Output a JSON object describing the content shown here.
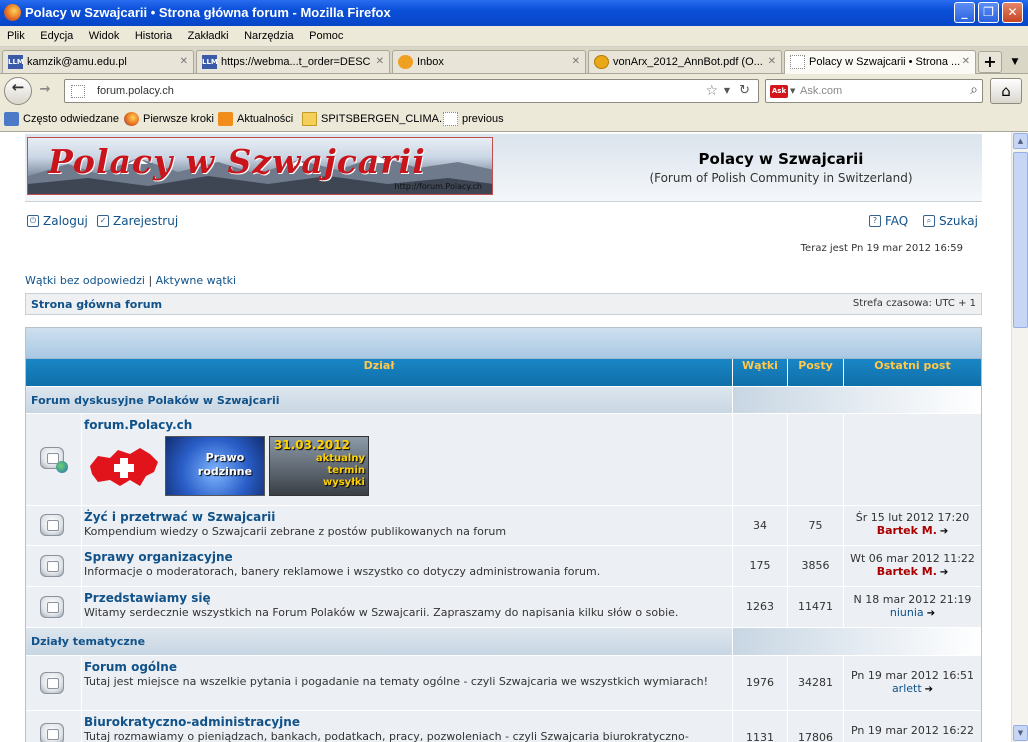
{
  "window": {
    "title": "Polacy w Szwajcarii • Strona główna forum - Mozilla Firefox",
    "controls": {
      "minimize": "_",
      "maximize": "❐",
      "close": "✕"
    }
  },
  "menu": [
    "Plik",
    "Edycja",
    "Widok",
    "Historia",
    "Zakładki",
    "Narzędzia",
    "Pomoc"
  ],
  "tabs": [
    {
      "label": "kamzik@amu.edu.pl",
      "icon": "llm",
      "icon_text": "LLM"
    },
    {
      "label": "https://webma...t_order=DESC",
      "icon": "llm",
      "icon_text": "LLM"
    },
    {
      "label": "Inbox",
      "icon": "inbox"
    },
    {
      "label": "vonArx_2012_AnnBot.pdf (O...",
      "icon": "pdf"
    },
    {
      "label": "Polacy w Szwajcarii • Strona ...",
      "icon": "blank",
      "active": true
    }
  ],
  "newtab": "+",
  "toolbar": {
    "url": "forum.polacy.ch",
    "search_placeholder": "Ask.com",
    "search_engine": "Ask"
  },
  "bookmarks": [
    {
      "label": "Często odwiedzane",
      "icon": "mv"
    },
    {
      "label": "Pierwsze kroki",
      "icon": "ff"
    },
    {
      "label": "Aktualności",
      "icon": "rss"
    },
    {
      "label": "SPITSBERGEN_CLIMA...",
      "icon": "folder"
    },
    {
      "label": "previous",
      "icon": "blank"
    }
  ],
  "site": {
    "logo_text": "Polacy w Szwajcarii",
    "logo_url": "http://forum.Polacy.ch",
    "title": "Polacy w Szwajcarii",
    "description": "(Forum of Polish Community in Switzerland)"
  },
  "userlinks": {
    "login": "Zaloguj",
    "register": "Zarejestruj",
    "faq": "FAQ",
    "search": "Szukaj"
  },
  "current_time": "Teraz jest Pn 19 mar 2012 16:59",
  "quicklinks": {
    "unanswered": "Wątki bez odpowiedzi",
    "sep": "|",
    "active": "Aktywne wątki"
  },
  "breadcrumb": "Strona główna forum",
  "timezone": "Strefa czasowa: UTC + 1",
  "table": {
    "headers": {
      "forum": "Dział",
      "topics": "Wątki",
      "posts": "Posty",
      "last": "Ostatni post"
    },
    "categories": [
      {
        "title": "Forum dyskusyjne Polaków w Szwajcarii"
      },
      {
        "title": "Działy tematyczne"
      }
    ],
    "banner": {
      "family_text": "Prawo rodzinne",
      "truck_date": "31.03.2012",
      "truck_text": "aktualny termin wysyłki"
    },
    "forums": [
      {
        "title": "forum.Polacy.ch"
      },
      {
        "title": "Żyć i przetrwać w Szwajcarii",
        "desc": "Kompendium wiedzy o Szwajcarii zebrane z postów publikowanych na forum",
        "topics": "34",
        "posts": "75",
        "last_date": "Śr 15 lut 2012 17:20",
        "last_author": "Bartek M."
      },
      {
        "title": "Sprawy organizacyjne",
        "desc": "Informacje o moderatorach, banery reklamowe i wszystko co dotyczy administrowania forum.",
        "topics": "175",
        "posts": "3856",
        "last_date": "Wt 06 mar 2012 11:22",
        "last_author": "Bartek M."
      },
      {
        "title": "Przedstawiamy się",
        "desc": "Witamy serdecznie wszystkich na Forum Polaków w Szwajcarii. Zapraszamy do napisania kilku słów o sobie.",
        "topics": "1263",
        "posts": "11471",
        "last_date": "N 18 mar 2012 21:19",
        "last_author": "niunia"
      },
      {
        "title": "Forum ogólne",
        "desc": "Tutaj jest miejsce na wszelkie pytania i pogadanie na tematy ogólne - czyli Szwajcaria we wszystkich wymiarach!",
        "topics": "1976",
        "posts": "34281",
        "last_date": "Pn 19 mar 2012 16:51",
        "last_author": "arlett"
      },
      {
        "title": "Biurokratyczno-administracyjne",
        "desc": "Tutaj rozmawiamy o pieniądzach, bankach, podatkach, pracy, pozwoleniach - czyli Szwajcaria biurokratyczno-",
        "topics": "1131",
        "posts": "17806",
        "last_date": "Pn 19 mar 2012 16:22",
        "last_author": ""
      }
    ]
  },
  "colors": {
    "link": "#105289",
    "header_bar": "#1a86c6",
    "header_text": "#ffc84a",
    "author_red": "#aa0000"
  }
}
